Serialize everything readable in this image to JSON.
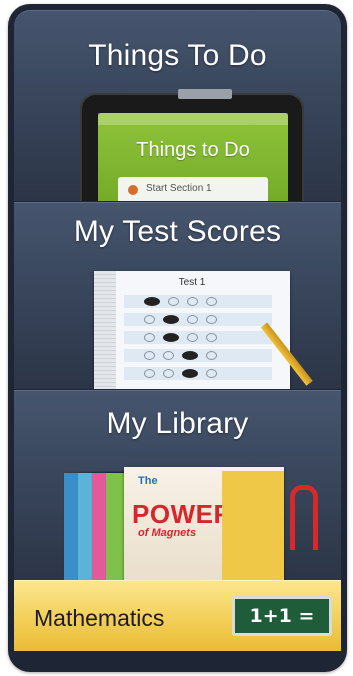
{
  "menu": {
    "things_to_do": {
      "title": "Things To Do",
      "thumbnail": {
        "screen_title": "Things to Do",
        "card_text": "Start Section 1"
      }
    },
    "test_scores": {
      "title": "My Test Scores",
      "thumbnail": {
        "sheet_title": "Test 1"
      }
    },
    "library": {
      "title": "My Library",
      "thumbnail": {
        "book_small": "The",
        "book_title": "POWER",
        "book_subtitle": "of Magnets"
      }
    },
    "subject": {
      "label": "Mathematics",
      "board_text": "1+1 ="
    }
  },
  "colors": {
    "frame": "#1e2534",
    "panel": "#3c4960",
    "subject_bar": "#f3cf58",
    "chalkboard": "#1f5c3a",
    "tablet_screen": "#7fb52e"
  }
}
